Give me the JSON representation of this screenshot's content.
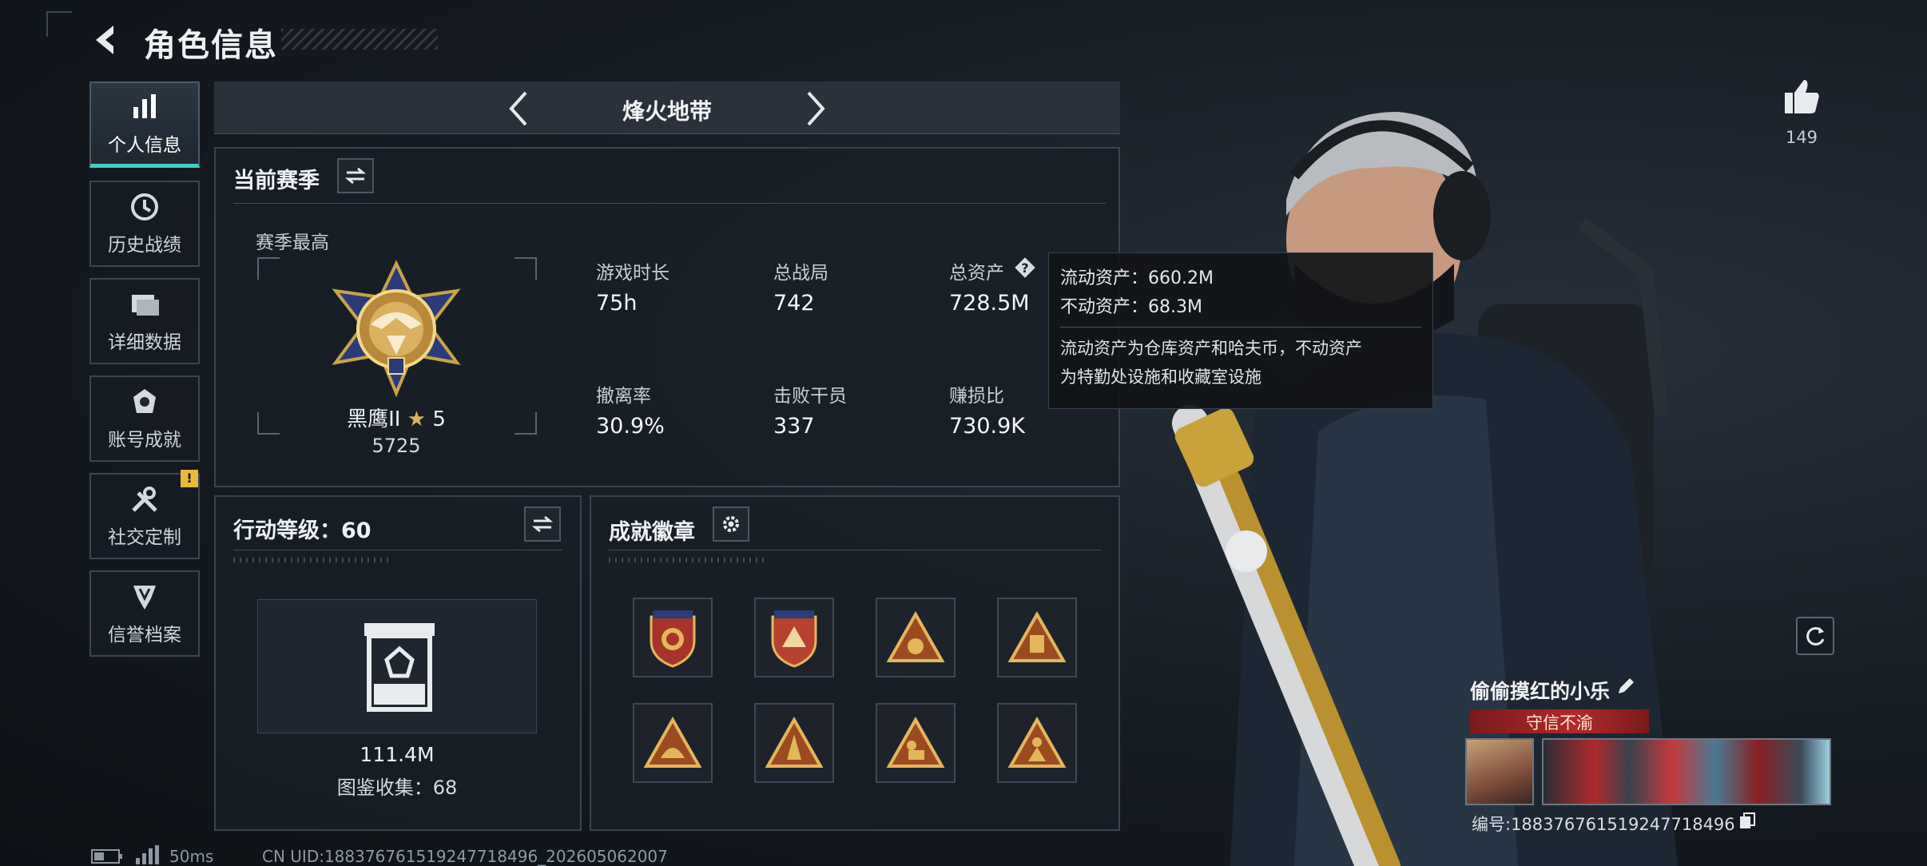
{
  "header": {
    "title": "角色信息"
  },
  "sidebar": {
    "items": [
      {
        "label": "个人信息",
        "icon": "bar-chart-icon",
        "active": true
      },
      {
        "label": "历史战绩",
        "icon": "clock-icon"
      },
      {
        "label": "详细数据",
        "icon": "folder-icon"
      },
      {
        "label": "账号成就",
        "icon": "achievement-icon"
      },
      {
        "label": "社交定制",
        "icon": "tools-icon",
        "alert": "!"
      },
      {
        "label": "信誉档案",
        "icon": "shield-icon"
      }
    ]
  },
  "mode": {
    "label": "烽火地带"
  },
  "season": {
    "title": "当前赛季",
    "best_label": "赛季最高",
    "rank_name": "黑鹰II",
    "rank_stars": "5",
    "rank_score": "5725",
    "stats": [
      {
        "label": "游戏时长",
        "value": "75h"
      },
      {
        "label": "总战局",
        "value": "742"
      },
      {
        "label": "总资产",
        "value": "728.5M"
      },
      {
        "label": "撤离率",
        "value": "30.9%"
      },
      {
        "label": "击败干员",
        "value": "337"
      },
      {
        "label": "赚损比",
        "value": "730.9K"
      }
    ]
  },
  "tooltip": {
    "liquid": "流动资产：660.2M",
    "fixed": "不动资产：68.3M",
    "desc_line1": "流动资产为仓库资产和哈夫币，不动资产",
    "desc_line2": "为特勤处设施和收藏室设施"
  },
  "action_level": {
    "title": "行动等级：60",
    "value": "111.4M",
    "collection": "图鉴收集：68"
  },
  "badges": {
    "title": "成就徽章",
    "items": [
      {
        "icon": "shield-badge-icon"
      },
      {
        "icon": "shield-badge-icon"
      },
      {
        "icon": "triangle-badge-icon"
      },
      {
        "icon": "triangle-badge-icon"
      },
      {
        "icon": "triangle-badge-icon"
      },
      {
        "icon": "triangle-badge-icon"
      },
      {
        "icon": "triangle-badge-icon"
      },
      {
        "icon": "triangle-badge-icon"
      }
    ]
  },
  "likes": {
    "count": "149"
  },
  "player": {
    "name": "偷偷摸红的小乐",
    "honor": "守信不渝",
    "id": "编号:188376761519247718496"
  },
  "footer": {
    "ping": "50ms",
    "uid": "CN UID:188376761519247718496_202605062007"
  },
  "colors": {
    "accent": "#3fd0c7",
    "alert": "#e8b93a",
    "honor": "#b22a2a"
  }
}
